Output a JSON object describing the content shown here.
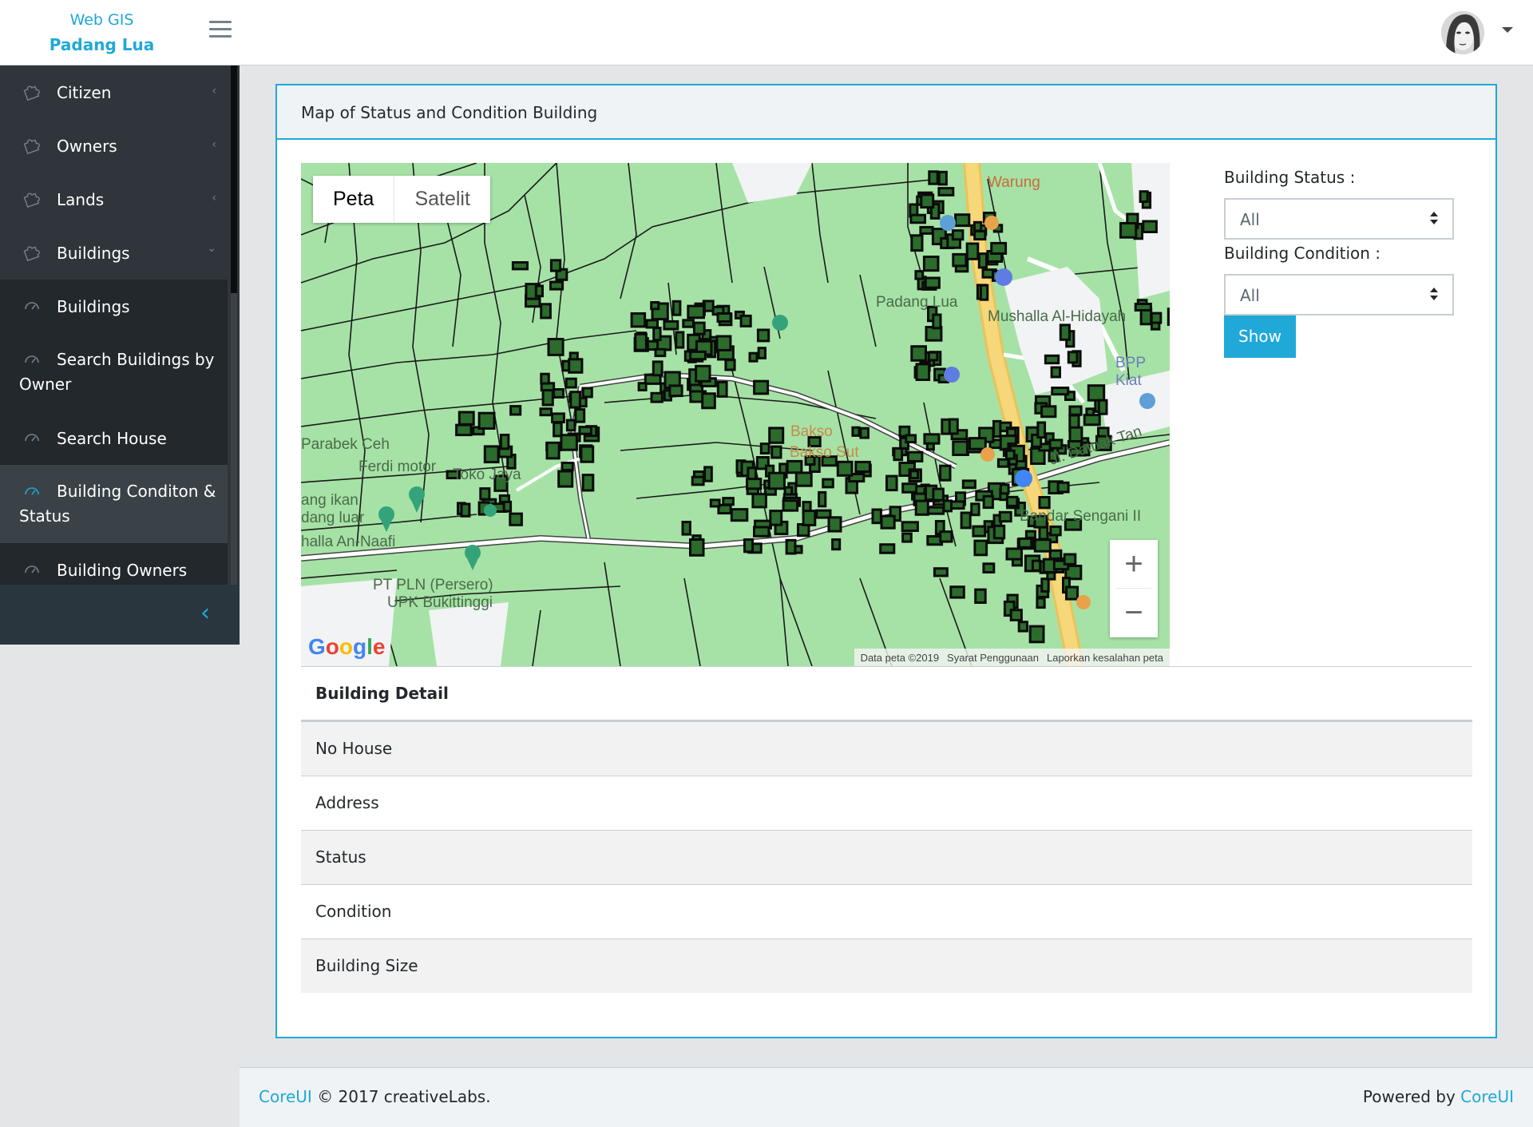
{
  "brand": {
    "line1": "Web GIS",
    "line2": "Padang Lua"
  },
  "header": {
    "avatar": "user-avatar",
    "menu_icon": "hamburger-icon"
  },
  "sidebar": {
    "items": [
      {
        "label": "Citizen",
        "icon": "puzzle-icon",
        "chevron": "‹"
      },
      {
        "label": "Owners",
        "icon": "puzzle-icon",
        "chevron": "‹"
      },
      {
        "label": "Lands",
        "icon": "puzzle-icon",
        "chevron": "‹"
      },
      {
        "label": "Buildings",
        "icon": "puzzle-icon",
        "chevron": "⌄"
      },
      {
        "label": "Buildings",
        "icon": "speedometer-icon"
      },
      {
        "label": "Search Buildings by Owner",
        "icon": "speedometer-icon"
      },
      {
        "label": "Search House",
        "icon": "speedometer-icon"
      },
      {
        "label": "Building Conditon & Status",
        "icon": "speedometer-icon"
      },
      {
        "label": "Building Owners",
        "icon": "speedometer-icon"
      }
    ],
    "minimizer": "‹"
  },
  "card": {
    "title": "Map of Status and Condition Building"
  },
  "map": {
    "type_buttons": [
      "Peta",
      "Satelit"
    ],
    "zoom_in": "+",
    "zoom_out": "−",
    "google_logo": "Google",
    "attribution": [
      "Data peta ©2019",
      "Syarat Penggunaan",
      "Laporkan kesalahan peta"
    ],
    "labels": [
      "Warung",
      "Bakso",
      "BPP",
      "Kiat",
      "Padang Lua",
      "Mushalla Al-Hidayah",
      "Parabek Ceh",
      "Ferdi motor",
      "Toko Jaya",
      "ang ikan",
      "dang luar",
      "halla An-Naafi",
      "PT PLN (Persero)",
      "UPK Bukittinggi",
      "Bakso Sut",
      "Jl. Datuak Tan",
      "Bandar Sengani II"
    ],
    "colors": {
      "land": "#a6e2a6",
      "building_stroke": "#0a0a0a",
      "road": "#ffffff",
      "main_road": "#f6d77a"
    }
  },
  "filters": {
    "status_label": "Building Status :",
    "status_value": "All",
    "condition_label": "Building Condition :",
    "condition_value": "All",
    "show_button": "Show"
  },
  "detail_table": {
    "header": "Building Detail",
    "rows": [
      "No House",
      "Address",
      "Status",
      "Condition",
      "Building Size"
    ]
  },
  "footer": {
    "left_link": "CoreUI",
    "left_text": "© 2017 creativeLabs.",
    "right_text": "Powered by",
    "right_link": "CoreUI"
  },
  "theme": {
    "accent": "#20a8d8",
    "sidebar_bg": "#2f353a"
  }
}
